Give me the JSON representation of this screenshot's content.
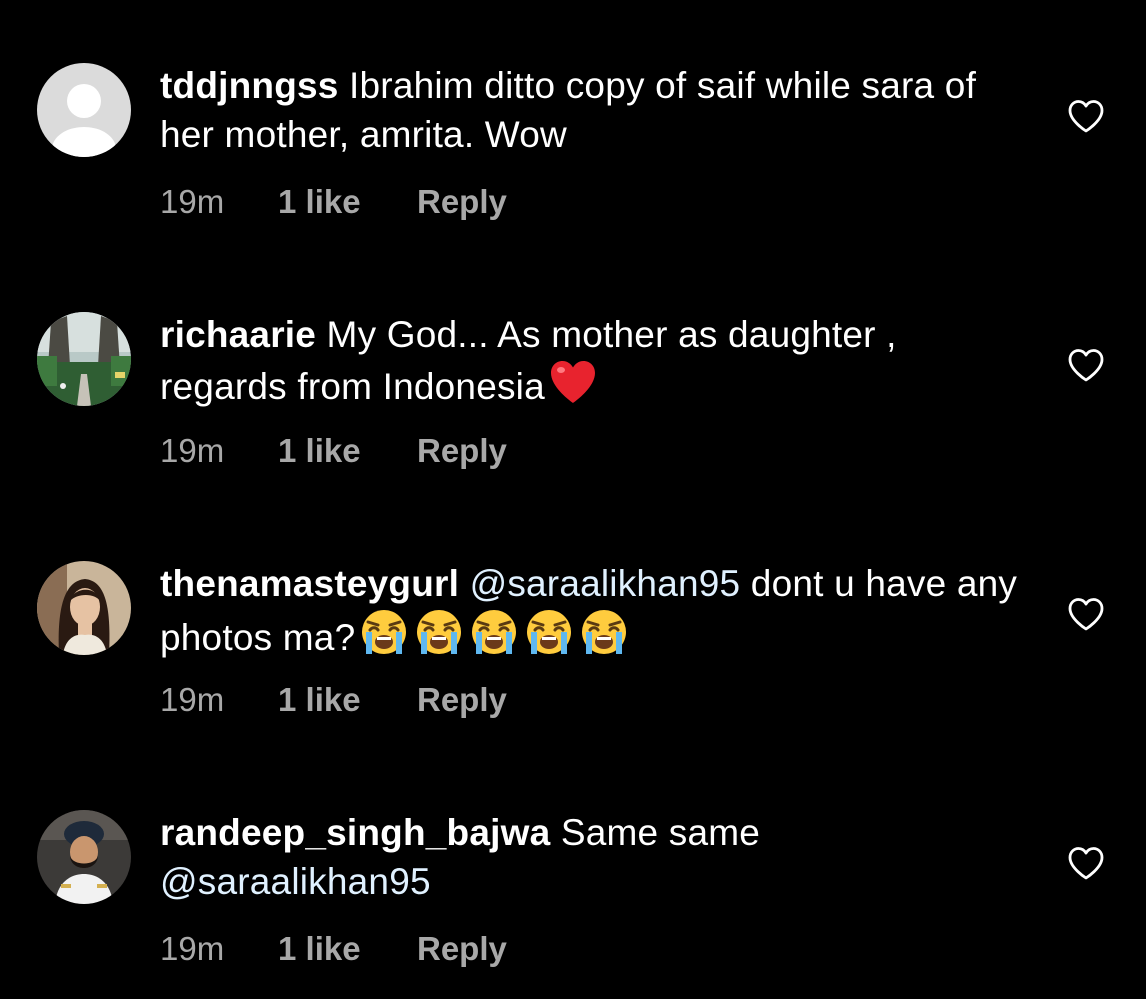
{
  "comments": [
    {
      "username": "tddjnngss",
      "text": " Ibrahim ditto copy of saif while sara of her mother, amrita. Wow",
      "time": "19m",
      "likes": "1 like",
      "reply": "Reply",
      "avatar": "default-profile-icon"
    },
    {
      "username": "richaarie",
      "text": " My God... As mother as daughter , regards from Indonesia",
      "time": "19m",
      "likes": "1 like",
      "reply": "Reply",
      "avatar": "gate-photo",
      "emoji": [
        "red-heart"
      ]
    },
    {
      "username": "thenamasteygurl",
      "mention": " @saraalikhan95",
      "text": " dont u have any photos ma?",
      "time": "19m",
      "likes": "1 like",
      "reply": "Reply",
      "avatar": "woman-photo",
      "emoji": [
        "crying-face",
        "crying-face",
        "crying-face",
        "crying-face",
        "crying-face"
      ]
    },
    {
      "username": "randeep_singh_bajwa",
      "text": " Same same ",
      "mention": "@saraalikhan95",
      "time": "19m",
      "likes": "1 like",
      "reply": "Reply",
      "avatar": "man-photo"
    }
  ],
  "colors": {
    "background": "#000000",
    "text": "#ffffff",
    "meta": "#a8a8a8",
    "mention": "#e0f1ff",
    "heart_emoji": "#e8232e"
  }
}
